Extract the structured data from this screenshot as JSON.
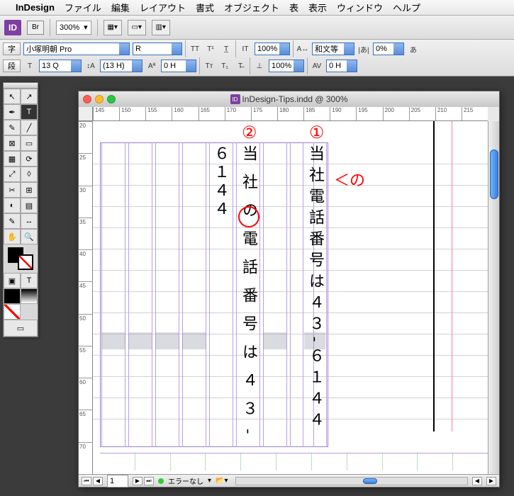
{
  "menubar": {
    "app": "InDesign",
    "items": [
      "ファイル",
      "編集",
      "レイアウト",
      "書式",
      "オブジェクト",
      "表",
      "表示",
      "ウィンドウ",
      "ヘルプ"
    ]
  },
  "toolbar1": {
    "id_badge": "ID",
    "br_badge": "Br",
    "zoom": "300%"
  },
  "toolbar2": {
    "ji": "字",
    "dan": "段",
    "font": "小塚明朝 Pro",
    "style": "R",
    "size": "13 Q",
    "leading": "(13 H)",
    "tracking1": "0 H",
    "tracking2": "0 H",
    "scale1": "100%",
    "scale2": "100%",
    "kinsoku": "和文等",
    "rot": "0%",
    "aa_label": "あ"
  },
  "window": {
    "title": "InDesign-Tips.indd @ 300%"
  },
  "ruler_h": [
    "145",
    "150",
    "155",
    "160",
    "165",
    "170",
    "175",
    "180",
    "185",
    "190",
    "195",
    "200",
    "205",
    "210",
    "215"
  ],
  "ruler_v": [
    "20",
    "25",
    "30",
    "35",
    "40",
    "45",
    "50",
    "55",
    "60",
    "65",
    "70"
  ],
  "content": {
    "col1_text": "当社電話番号は４３‐６１４４",
    "col2_text": "当社の電話番号は４３‐",
    "col3_text": "６１４４"
  },
  "annotations": {
    "marker1": "①",
    "marker2": "②",
    "arrow_no": "＜の"
  },
  "statusbar": {
    "page": "1",
    "errors": "エラーなし"
  }
}
